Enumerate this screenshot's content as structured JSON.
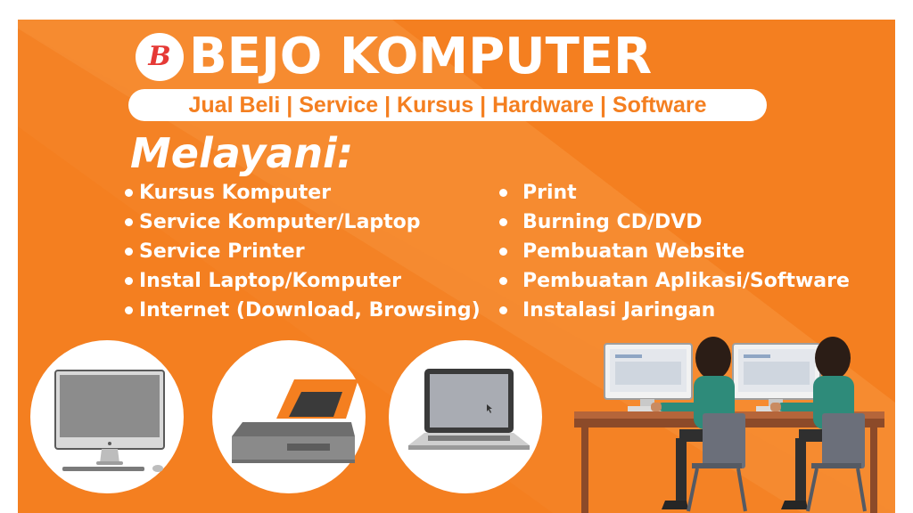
{
  "brand": {
    "logo_text": "B",
    "title": "BEJO KOMPUTER",
    "tagline": "Jual Beli | Service | Kursus | Hardware | Software"
  },
  "services_heading": "Melayani:",
  "services_left": [
    "Kursus Komputer",
    "Service Komputer/Laptop",
    "Service Printer",
    "Instal Laptop/Komputer",
    "Internet (Download, Browsing)"
  ],
  "services_right": [
    "Print",
    "Burning CD/DVD",
    "Pembuatan Website",
    "Pembuatan Aplikasi/Software",
    "Instalasi Jaringan"
  ],
  "illustrations": [
    "desktop-computer-icon",
    "printer-icon",
    "laptop-icon",
    "people-at-computers-illustration"
  ],
  "colors": {
    "background": "#f47f20",
    "diagonal_accent": "#f8953e",
    "text": "#ffffff",
    "logo_red": "#e53935",
    "shirt": "#2e8b7a",
    "hair": "#2b1d16"
  }
}
